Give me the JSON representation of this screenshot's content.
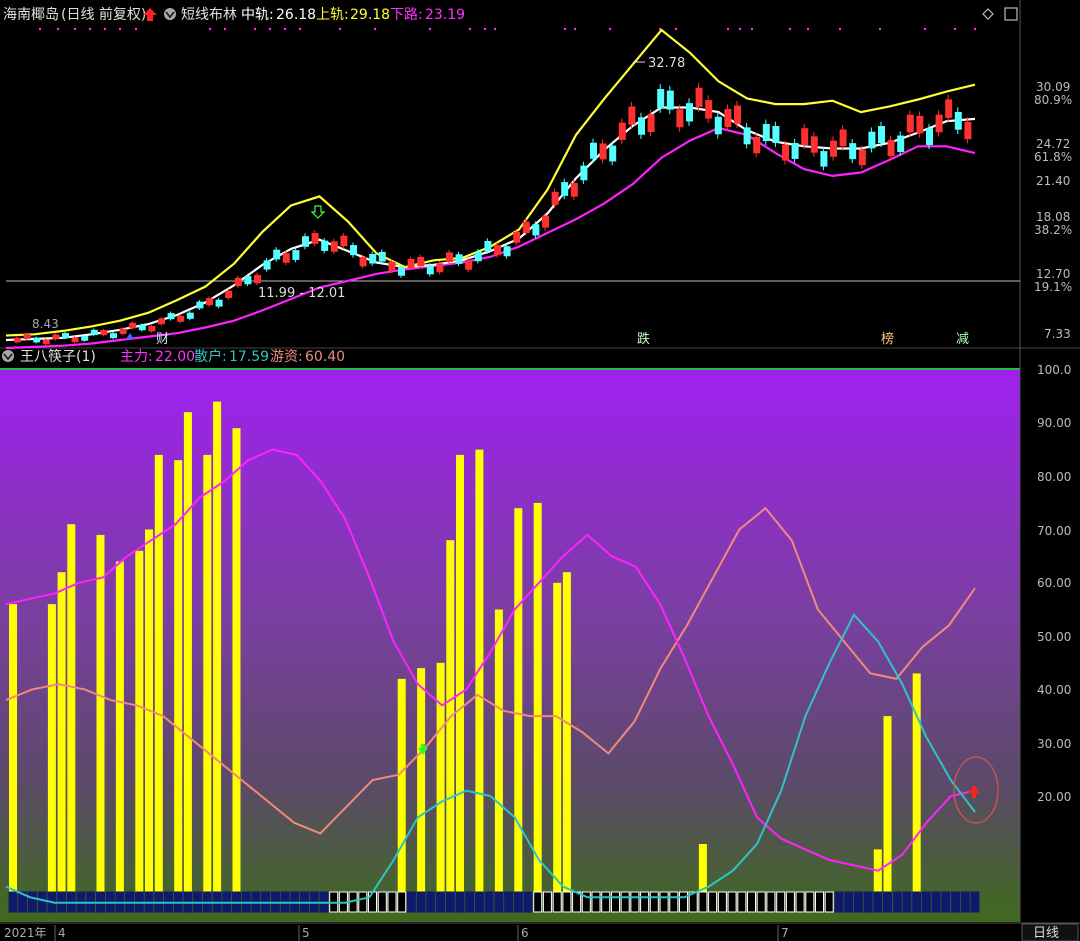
{
  "top": {
    "stock": "海南椰岛",
    "period": "(日线 前复权)",
    "indicator": "短线布林",
    "mid_label": "中轨:",
    "mid_value": "26.18",
    "up_label": "上轨:",
    "up_value": "29.18",
    "down_label": "下路:",
    "down_value": "23.19",
    "peak_annotation": "32.78",
    "range_annotation": "11.99 - 12.01",
    "low_annotation": "8.43",
    "event_markers": [
      "财",
      "跌",
      "榜",
      "减"
    ],
    "yaxis": [
      {
        "label": "30.09",
        "pct": "80.9%"
      },
      {
        "label": "24.72",
        "pct": "61.8%"
      },
      {
        "label": "21.40",
        "pct": ""
      },
      {
        "label": "18.08",
        "pct": "38.2%"
      },
      {
        "label": "12.70",
        "pct": "19.1%"
      },
      {
        "label": "7.33",
        "pct": ""
      }
    ]
  },
  "bottom": {
    "indicator": "王八筷子(1)",
    "main_label": "主力:",
    "main_value": "22.00",
    "retail_label": "散户:",
    "retail_value": "17.59",
    "hot_label": "游资:",
    "hot_value": "60.40",
    "yaxis": [
      "100.0",
      "90.00",
      "80.00",
      "70.00",
      "60.00",
      "50.00",
      "40.00",
      "30.00",
      "20.00"
    ]
  },
  "xaxis": {
    "labels": [
      "2021年",
      "4",
      "5",
      "6",
      "7"
    ],
    "period_button": "日线"
  },
  "colors": {
    "bar": "#ffff00",
    "main": "#ff22ff",
    "retail": "#2ec4c4",
    "hot": "#f08a7c",
    "upper": "#ffff33",
    "mid": "#ffffff",
    "lower": "#ff22ff",
    "up_candle": "#ff3030",
    "down_candle": "#55ffff"
  },
  "chart_data": [
    {
      "type": "line",
      "title": "短线布林",
      "series": [
        {
          "name": "上轨",
          "values": [
            7.2,
            7.3,
            7.6,
            8.0,
            8.5,
            9.2,
            10.3,
            11.5,
            13.5,
            16.3,
            18.6,
            19.4,
            17.2,
            14.4,
            13.2,
            13.8,
            14.0,
            15.0,
            16.5,
            20.0,
            24.8,
            28.0,
            31.0,
            34.0,
            32.0,
            29.5,
            28.0,
            27.5,
            27.5,
            27.8,
            26.8,
            27.3,
            27.9,
            28.6,
            29.2
          ]
        },
        {
          "name": "中轨",
          "values": [
            6.8,
            6.9,
            7.0,
            7.3,
            7.7,
            8.2,
            9.0,
            10.1,
            11.6,
            13.4,
            14.8,
            15.6,
            14.6,
            13.6,
            13.2,
            13.4,
            13.8,
            14.6,
            15.7,
            17.9,
            21.0,
            23.5,
            25.6,
            27.2,
            27.2,
            26.8,
            25.2,
            24.2,
            23.8,
            23.6,
            23.6,
            24.1,
            25.0,
            26.0,
            26.2
          ]
        },
        {
          "name": "下路",
          "values": [
            6.1,
            6.2,
            6.3,
            6.5,
            6.8,
            7.1,
            7.4,
            7.9,
            8.5,
            9.4,
            10.4,
            11.4,
            12.0,
            12.6,
            13.0,
            13.3,
            13.6,
            14.1,
            15.0,
            16.2,
            17.4,
            18.8,
            20.5,
            22.8,
            24.3,
            25.4,
            24.8,
            23.2,
            21.8,
            21.2,
            21.5,
            22.6,
            23.8,
            23.8,
            23.2
          ]
        }
      ],
      "ylim": [
        7.33,
        34.0
      ]
    },
    {
      "type": "bar",
      "title": "王八筷子(1)",
      "bar_values": [
        57,
        0,
        0,
        0,
        57,
        63,
        72,
        0,
        0,
        70,
        0,
        65,
        0,
        67,
        71,
        85,
        0,
        84,
        93,
        0,
        85,
        95,
        0,
        90,
        0,
        0,
        0,
        0,
        0,
        0,
        0,
        0,
        0,
        0,
        0,
        0,
        0,
        0,
        0,
        0,
        43,
        0,
        45,
        0,
        46,
        69,
        85,
        0,
        86,
        0,
        56,
        0,
        75,
        0,
        76,
        0,
        61,
        63,
        0,
        0,
        0,
        0,
        0,
        0,
        0,
        0,
        0,
        0,
        0,
        0,
        0,
        12,
        0,
        0,
        0,
        0,
        0,
        0,
        0,
        0,
        0,
        0,
        0,
        3,
        0,
        0,
        0,
        0,
        0,
        11,
        36,
        0,
        0,
        44,
        0,
        0,
        0,
        0,
        0,
        0
      ],
      "series": [
        {
          "name": "主力",
          "values": [
            57,
            58,
            59,
            61,
            62,
            66,
            69,
            72,
            77,
            80,
            84,
            86,
            85,
            80,
            73,
            62,
            50,
            42,
            38,
            41,
            48,
            56,
            61,
            66,
            70,
            66,
            64,
            57,
            47,
            36,
            27,
            17,
            13,
            11,
            9,
            8,
            7,
            10,
            16,
            21,
            22
          ]
        },
        {
          "name": "散户",
          "values": [
            4,
            2,
            1,
            1,
            1,
            1,
            1,
            1,
            1,
            1,
            1,
            1,
            1,
            1,
            1,
            2,
            9,
            17,
            20,
            22,
            21,
            17,
            9,
            4,
            2,
            2,
            2,
            2,
            2,
            4,
            7,
            12,
            22,
            36,
            46,
            55,
            50,
            42,
            32,
            24,
            18
          ]
        },
        {
          "name": "游资",
          "values": [
            39,
            41,
            42,
            41,
            39,
            38,
            36,
            32,
            28,
            24,
            20,
            16,
            14,
            19,
            24,
            25,
            30,
            36,
            40,
            37,
            36,
            36,
            33,
            29,
            35,
            45,
            53,
            62,
            71,
            75,
            69,
            56,
            50,
            44,
            43,
            49,
            53,
            60
          ]
        }
      ],
      "ylim": [
        0,
        100
      ]
    }
  ]
}
